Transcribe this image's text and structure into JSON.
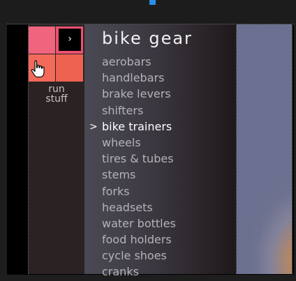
{
  "header": {
    "arrow_glyph": "›"
  },
  "side": {
    "label_line1": "run",
    "label_line2": "stuff"
  },
  "menu": {
    "title": "bike gear",
    "active_marker": ">",
    "items": [
      {
        "label": "aerobars",
        "active": false
      },
      {
        "label": "handlebars",
        "active": false
      },
      {
        "label": "brake levers",
        "active": false
      },
      {
        "label": "shifters",
        "active": false
      },
      {
        "label": "bike trainers",
        "active": true
      },
      {
        "label": "wheels",
        "active": false
      },
      {
        "label": "tires & tubes",
        "active": false
      },
      {
        "label": "stems",
        "active": false
      },
      {
        "label": "forks",
        "active": false
      },
      {
        "label": "headsets",
        "active": false
      },
      {
        "label": "water bottles",
        "active": false
      },
      {
        "label": "food holders",
        "active": false
      },
      {
        "label": "cycle shoes",
        "active": false
      },
      {
        "label": "cranks",
        "active": false
      }
    ]
  },
  "colors": {
    "tile_pink": "#f0647e",
    "tile_coral": "#f26a5a",
    "menu_text": "#b6b2b8",
    "active_text": "#ffffff"
  },
  "icons": {
    "cursor": "hand-pointer-icon",
    "arrow": "chevron-right-icon"
  }
}
